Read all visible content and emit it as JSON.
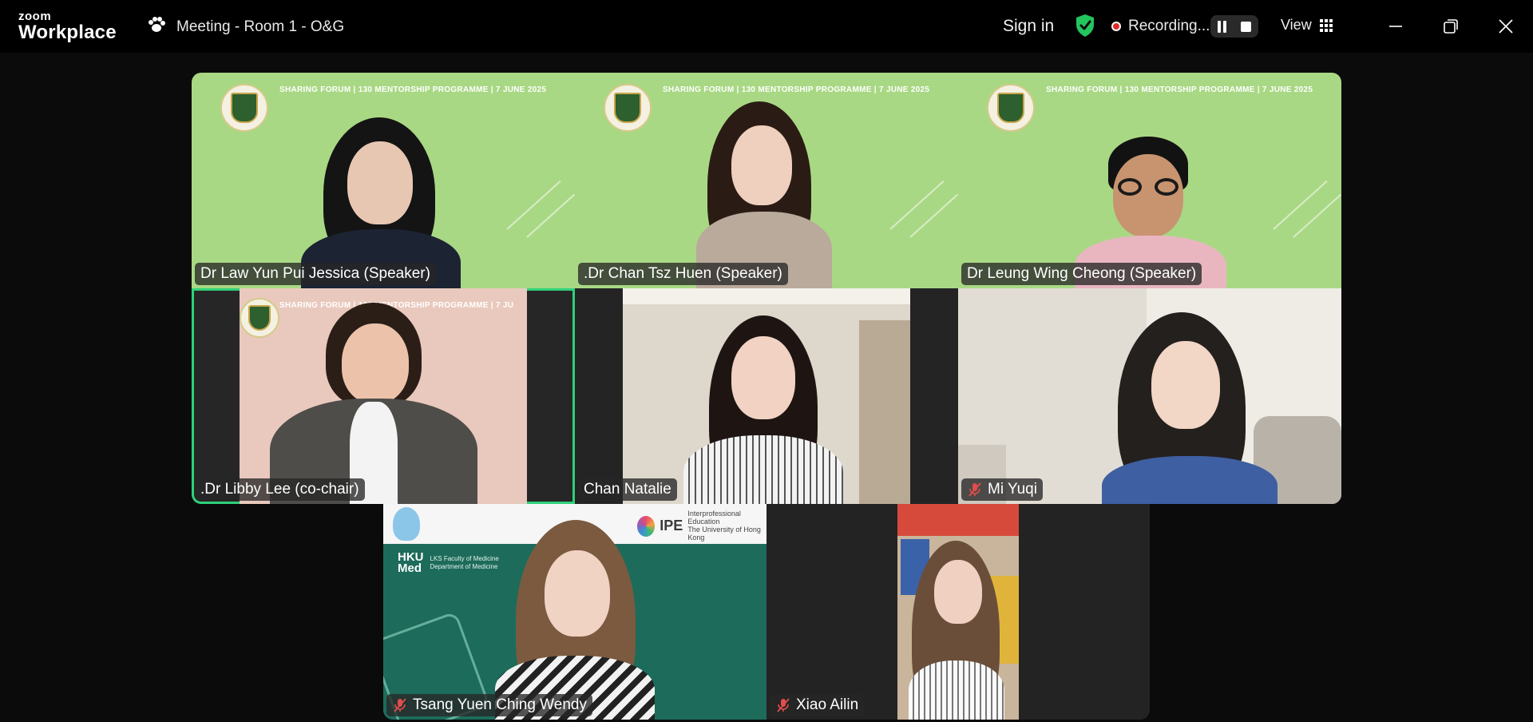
{
  "app": {
    "logo_line1": "zoom",
    "logo_line2": "Workplace",
    "meeting_title": "Meeting - Room 1 - O&G"
  },
  "toolbar": {
    "sign_in": "Sign in",
    "recording_text": "Recording...",
    "view_label": "View"
  },
  "tiles": [
    {
      "name": "Dr Law Yun Pui Jessica (Speaker)",
      "banner": "SHARING FORUM  |  130 MENTORSHIP PROGRAMME  |  7 JUNE 2025",
      "muted": false,
      "active": false
    },
    {
      "name": ".Dr Chan Tsz Huen (Speaker)",
      "banner": "SHARING FORUM  |  130 MENTORSHIP PROGRAMME  |  7 JUNE 2025",
      "muted": false,
      "active": false
    },
    {
      "name": "Dr Leung Wing Cheong (Speaker)",
      "banner": "SHARING FORUM  |  130 MENTORSHIP PROGRAMME  |  7 JUNE 2025",
      "muted": false,
      "active": false
    },
    {
      "name": ".Dr Libby Lee (co-chair)",
      "banner": "SHARING FORUM  |  130 MENTORSHIP PROGRAMME  |  7 JU",
      "muted": false,
      "active": true
    },
    {
      "name": "Chan Natalie",
      "muted": false,
      "active": false
    },
    {
      "name": "Mi Yuqi",
      "muted": true,
      "active": false
    },
    {
      "name": "Tsang Yuen Ching Wendy",
      "muted": true,
      "active": false,
      "logo_text": "Interprofessional Education",
      "logo_subtext": "The University of Hong Kong",
      "hku_line1": "HKU",
      "hku_line2": "Med",
      "hku_sub1": "LKS Faculty of Medicine",
      "hku_sub2": "Department of Medicine"
    },
    {
      "name": "Xiao Ailin",
      "muted": true,
      "active": false
    }
  ],
  "colors": {
    "accent_active": "#2fd17a",
    "recording_red": "#e02b2b",
    "secure_green": "#23c55e",
    "speaker_background": "#a9d884",
    "wendy_background": "#1d6b5b"
  },
  "icons": {
    "meeting": "paw-icon",
    "security": "shield-check-icon",
    "record": "record-dot-icon",
    "pause": "pause-icon",
    "stop": "stop-icon",
    "view": "grid-icon",
    "minimize": "minimize-icon",
    "maximize": "restore-icon",
    "close": "close-icon",
    "muted": "mic-muted-icon"
  }
}
